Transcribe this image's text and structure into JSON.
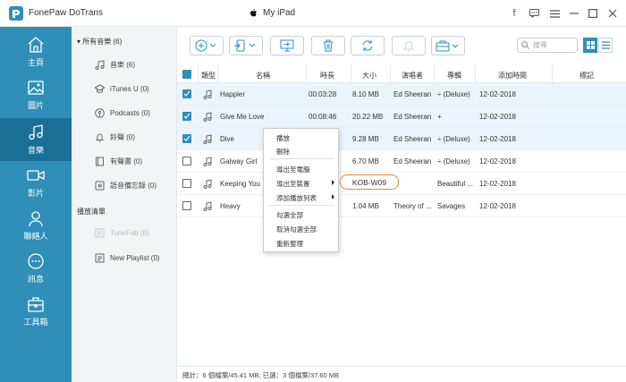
{
  "app": {
    "name": "FonePaw DoTrans"
  },
  "device": {
    "name": "My iPad"
  },
  "window_controls": [
    "facebook-icon",
    "feedback-icon",
    "menu-icon",
    "minimize-icon",
    "maximize-icon",
    "close-icon"
  ],
  "sidebar": {
    "items": [
      {
        "label": "主頁",
        "icon": "home-icon"
      },
      {
        "label": "圖片",
        "icon": "photo-icon"
      },
      {
        "label": "音樂",
        "icon": "music-icon",
        "active": true
      },
      {
        "label": "影片",
        "icon": "video-icon"
      },
      {
        "label": "聯絡人",
        "icon": "contacts-icon"
      },
      {
        "label": "訊息",
        "icon": "message-icon"
      },
      {
        "label": "工具箱",
        "icon": "toolbox-icon"
      }
    ]
  },
  "panel": {
    "all_music": "所有音樂 (6)",
    "items": [
      {
        "label": "音樂 (6)",
        "icon": "music-note-icon"
      },
      {
        "label": "iTunes U (0)",
        "icon": "itunes-u-icon"
      },
      {
        "label": "Podcasts (0)",
        "icon": "podcast-icon"
      },
      {
        "label": "鈴聲 (0)",
        "icon": "bell-icon"
      },
      {
        "label": "有聲書 (0)",
        "icon": "audiobook-icon"
      },
      {
        "label": "語音備忘錄 (0)",
        "icon": "voice-memo-icon"
      }
    ],
    "playlists_heading": "播放清單",
    "playlists": [
      {
        "label": "TuneFab (6)",
        "muted": true
      },
      {
        "label": "New Playlist (0)",
        "muted": false
      }
    ]
  },
  "toolbar": {
    "buttons": [
      "add-icon",
      "export-to-device-icon",
      "export-to-pc-icon",
      "delete-icon",
      "sync-icon",
      "ringtone-icon",
      "toolbox-dropdown-icon"
    ],
    "search_placeholder": "搜尋"
  },
  "table": {
    "headers": {
      "type": "類型",
      "name": "名稱",
      "duration": "時長",
      "size": "大小",
      "artist": "演唱者",
      "album": "專輯",
      "date_added": "添加時間",
      "tags": "標記"
    },
    "rows": [
      {
        "checked": true,
        "selected": true,
        "name": "Happier",
        "duration": "00:03:28",
        "size": "8.10 MB",
        "artist": "Ed Sheeran",
        "album": "÷ (Deluxe)",
        "date": "12-02-2018"
      },
      {
        "checked": true,
        "selected": true,
        "name": "Give Me Love",
        "duration": "00:08:46",
        "size": "20.22 MB",
        "artist": "Ed Sheeran",
        "album": "+",
        "date": "12-02-2018"
      },
      {
        "checked": true,
        "selected": true,
        "name": "Dive",
        "duration": "",
        "size": "9.28 MB",
        "artist": "Ed Sheeran",
        "album": "÷ (Deluxe)",
        "date": "12-02-2018"
      },
      {
        "checked": false,
        "selected": false,
        "name": "Galway Girl",
        "duration": "",
        "size": "6.70 MB",
        "artist": "Ed Sheeran",
        "album": "÷ (Deluxe)",
        "date": "12-02-2018"
      },
      {
        "checked": false,
        "selected": false,
        "name": "Keeping You",
        "duration": "",
        "size": "",
        "artist": "",
        "album": "Beautiful ...",
        "date": "12-02-2018"
      },
      {
        "checked": false,
        "selected": false,
        "name": "Heavy",
        "duration": "",
        "size": "1.04 MB",
        "artist": "Theory of ...",
        "album": "Savages",
        "date": "12-02-2018"
      }
    ]
  },
  "context_menu": {
    "play": "播放",
    "delete": "刪除",
    "export_pc": "導出至電腦",
    "export_device": "導出至裝置",
    "add_playlist": "添加播放列表",
    "check_all": "勾選全部",
    "uncheck_all": "取消勾選全部",
    "refresh": "重新整理",
    "submenu_device": "KOB-W09"
  },
  "status": {
    "text": "總計：6 個檔案/45.41 MB; 已選：3 個檔案/37.60 MB"
  },
  "colors": {
    "accent": "#2f8fb8",
    "sidebar_active": "#1a6f96",
    "submenu_border": "#e08a3a"
  }
}
